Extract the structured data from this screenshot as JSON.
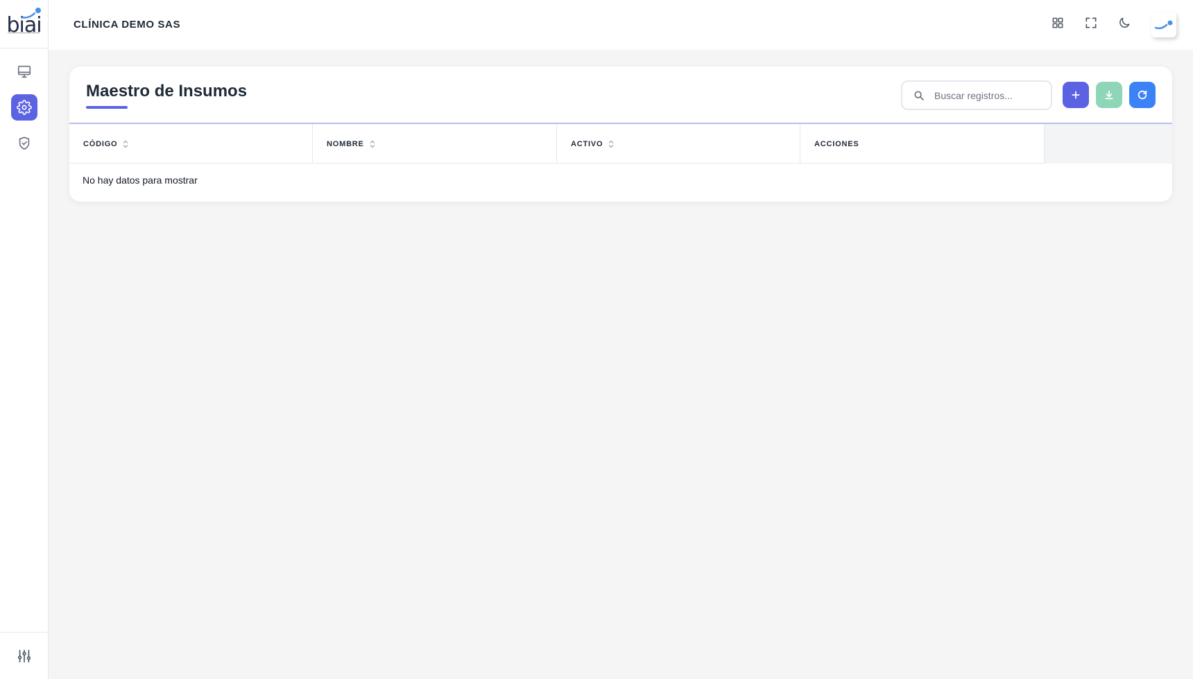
{
  "app": {
    "logo_text": "biai",
    "company_name": "CLÍNICA DEMO SAS",
    "accent_color": "#5c63e2"
  },
  "sidebar": {
    "items": [
      {
        "icon": "monitor-icon",
        "active": false
      },
      {
        "icon": "gear-icon",
        "active": true
      },
      {
        "icon": "shield-check-icon",
        "active": false
      }
    ],
    "bottom_icon": "sliders-icon"
  },
  "header_icons": [
    "apps-grid-icon",
    "fullscreen-icon",
    "moon-icon",
    "avatar"
  ],
  "page": {
    "title": "Maestro de Insumos",
    "search_placeholder": "Buscar registros...",
    "buttons": {
      "add": {
        "icon": "plus-icon",
        "color": "#5c63e2"
      },
      "export": {
        "icon": "download-icon",
        "color": "#8fd6b9"
      },
      "refresh": {
        "icon": "refresh-icon",
        "color": "#3b82f6"
      }
    }
  },
  "table": {
    "columns": [
      {
        "label": "CÓDIGO",
        "sortable": true
      },
      {
        "label": "NOMBRE",
        "sortable": true
      },
      {
        "label": "ACTIVO",
        "sortable": true
      },
      {
        "label": "ACCIONES",
        "sortable": false
      }
    ],
    "rows": [],
    "empty_message": "No hay datos para mostrar"
  }
}
